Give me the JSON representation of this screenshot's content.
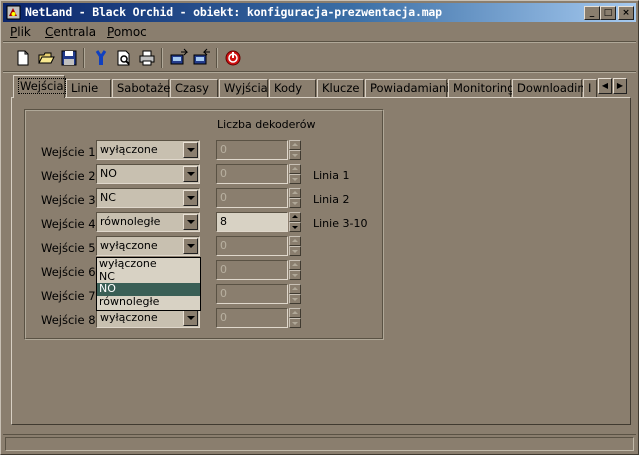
{
  "window": {
    "title": "NetLand - Black Orchid - obiekt: konfiguracja-prezwentacja.map",
    "buttons": {
      "minimize": "_",
      "maximize": "□",
      "close": "×"
    }
  },
  "menu": {
    "items": [
      {
        "label": "Plik"
      },
      {
        "label": "Centrala"
      },
      {
        "label": "Pomoc"
      }
    ]
  },
  "toolbar": {
    "icons": [
      "new-file-icon",
      "open-folder-icon",
      "save-icon",
      "connect-icon",
      "print-preview-icon",
      "print-icon",
      "send-icon",
      "receive-icon",
      "stop-icon"
    ]
  },
  "tabs": [
    {
      "label": "Wejścia",
      "active": true
    },
    {
      "label": "Linie"
    },
    {
      "label": "Sabotaże"
    },
    {
      "label": "Czasy"
    },
    {
      "label": "Wyjścia"
    },
    {
      "label": "Kody"
    },
    {
      "label": "Klucze"
    },
    {
      "label": "Powiadamianie"
    },
    {
      "label": "Monitoring"
    },
    {
      "label": "Downloading"
    },
    {
      "label": "I"
    }
  ],
  "inputs": {
    "column_header": "Liczba dekoderów",
    "rows": [
      {
        "label": "Wejście 1",
        "mode": "wyłączone",
        "decoders": "0",
        "enabled": false,
        "note": ""
      },
      {
        "label": "Wejście 2",
        "mode": "NO",
        "decoders": "0",
        "enabled": false,
        "note": "Linia 1"
      },
      {
        "label": "Wejście 3",
        "mode": "NC",
        "decoders": "0",
        "enabled": false,
        "note": "Linia 2"
      },
      {
        "label": "Wejście 4",
        "mode": "równoległe",
        "decoders": "8",
        "enabled": true,
        "note": "Linie 3-10"
      },
      {
        "label": "Wejście 5",
        "mode": "wyłączone",
        "decoders": "0",
        "enabled": false,
        "note": ""
      },
      {
        "label": "Wejście 6",
        "mode": "",
        "decoders": "0",
        "enabled": false,
        "note": ""
      },
      {
        "label": "Wejście 7",
        "mode": "",
        "decoders": "0",
        "enabled": false,
        "note": ""
      },
      {
        "label": "Wejście 8",
        "mode": "wyłączone",
        "decoders": "0",
        "enabled": false,
        "note": ""
      }
    ],
    "dropdown_options": [
      {
        "label": "wyłączone"
      },
      {
        "label": "NC"
      },
      {
        "label": "NO",
        "selected": true
      },
      {
        "label": "równoległe"
      }
    ]
  },
  "colors": {
    "face": "#8a7e6e",
    "titlebar": "#0a246a",
    "selection": "#3a5f56"
  }
}
